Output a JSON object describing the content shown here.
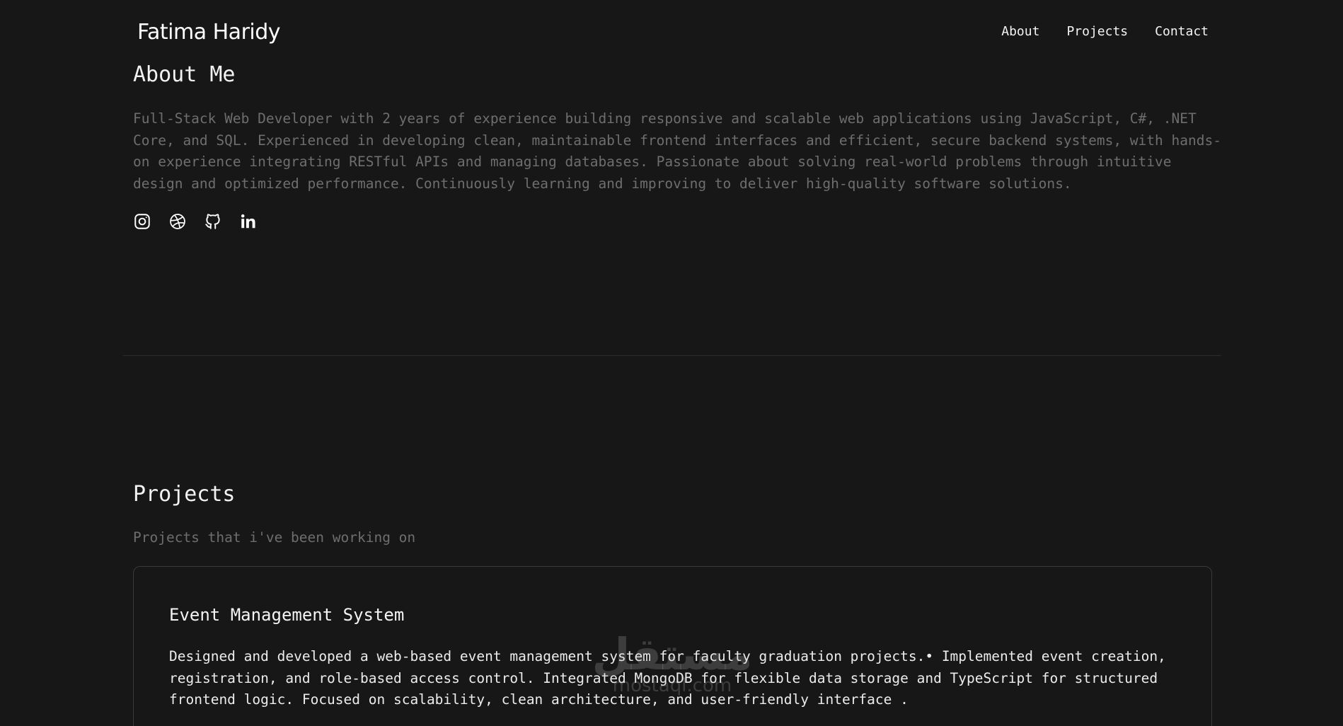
{
  "header": {
    "brand": "Fatima Haridy",
    "nav": [
      {
        "label": "About"
      },
      {
        "label": "Projects"
      },
      {
        "label": "Contact"
      }
    ]
  },
  "about": {
    "title": "About Me",
    "text": "Full-Stack Web Developer with 2 years of experience building responsive and scalable web applications using JavaScript, C#, .NET Core, and SQL. Experienced in developing clean, maintainable frontend interfaces and efficient, secure backend systems, with hands-on experience integrating RESTful APIs and managing databases. Passionate about solving real-world problems through intuitive design and optimized performance. Continuously learning and improving to deliver high-quality software solutions.",
    "socials": [
      {
        "icon": "instagram-icon"
      },
      {
        "icon": "dribbble-icon"
      },
      {
        "icon": "github-icon"
      },
      {
        "icon": "linkedin-icon"
      }
    ]
  },
  "projects": {
    "title": "Projects",
    "subtitle": "Projects that i've been working on",
    "items": [
      {
        "title": "Event Management System",
        "description": "Designed and developed a web-based event management system for faculty graduation projects.• Implemented event creation, registration, and role-based access control. Integrated MongoDB for flexible data storage and TypeScript for structured frontend logic. Focused on scalability, clean architecture, and user-friendly interface ."
      }
    ]
  },
  "watermark": {
    "arabic": "مستقل",
    "latin": "mostaql.com"
  },
  "colors": {
    "background": "#171717",
    "muted_text": "#6e6e6e",
    "text": "#f2f2f2",
    "border": "#3a3a3a"
  }
}
